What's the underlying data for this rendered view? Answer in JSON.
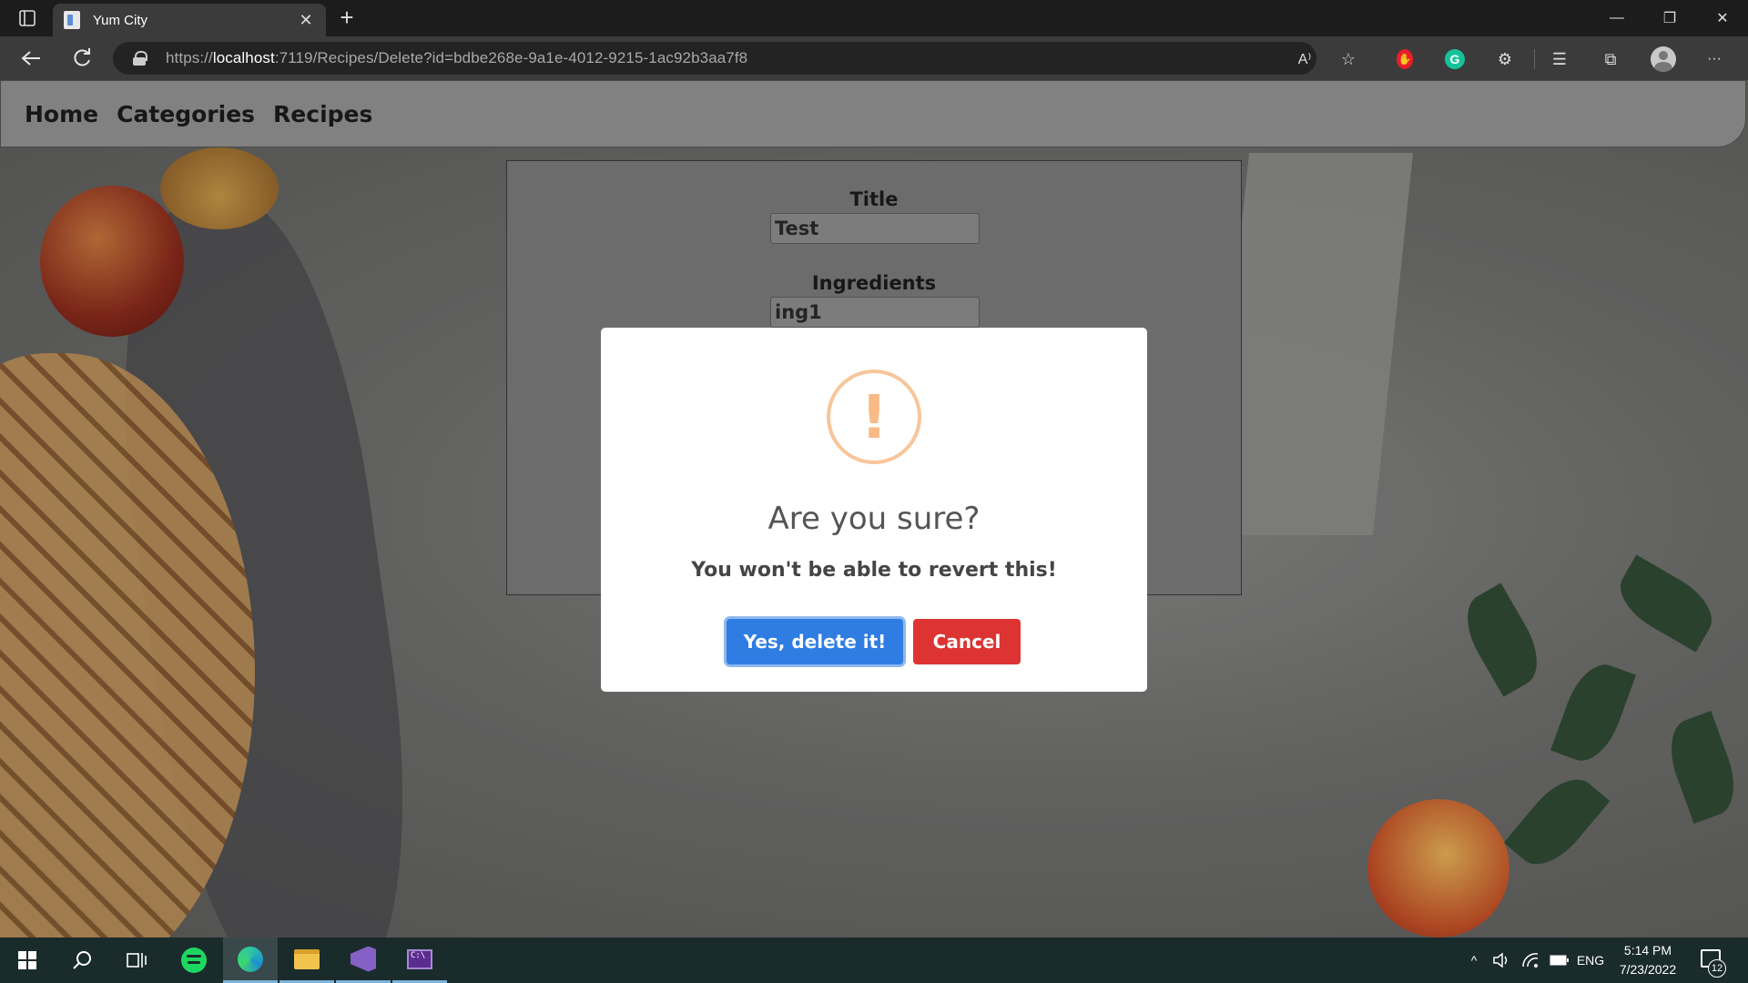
{
  "browser": {
    "tab": {
      "title": "Yum City",
      "close_glyph": "✕"
    },
    "new_tab_glyph": "+",
    "window_controls": {
      "minimize": "—",
      "restore": "❐",
      "close": "✕"
    },
    "url": {
      "scheme": "https://",
      "host": "localhost",
      "rest": ":7119/Recipes/Delete?id=bdbe268e-9a1e-4012-9215-1ac92b3aa7f8"
    },
    "icons": [
      "back-arrow-icon",
      "refresh-icon",
      "lock-icon",
      "read-aloud-icon",
      "add-favorite-icon",
      "extension-red-icon",
      "grammarly-icon",
      "extensions-icon",
      "favorites-icon",
      "collections-icon",
      "profile-icon",
      "more-icon"
    ],
    "read_aloud_glyph": "A⁾",
    "grammarly_letter": "G",
    "more_glyph": "···"
  },
  "site": {
    "nav": [
      "Home",
      "Categories",
      "Recipes"
    ],
    "form": {
      "title_label": "Title",
      "title_value": "Test",
      "ingredients_label": "Ingredients",
      "ingredients_value": "ing1"
    }
  },
  "dialog": {
    "icon": "!",
    "title": "Are you sure?",
    "text": "You won't be able to revert this!",
    "confirm_label": "Yes, delete it!",
    "cancel_label": "Cancel",
    "colors": {
      "confirm": "#2f7de3",
      "cancel": "#dd3333",
      "warning": "#f8bb86"
    }
  },
  "taskbar": {
    "apps": [
      "windows-start",
      "search",
      "task-view",
      "spotify",
      "edge",
      "file-explorer",
      "visual-studio",
      "terminal"
    ],
    "tray": {
      "chevron": "^",
      "volume": "🔊",
      "network": "📶",
      "battery": "▭",
      "language": "ENG"
    },
    "time": "5:14 PM",
    "date": "7/23/2022",
    "notifications": "12"
  }
}
